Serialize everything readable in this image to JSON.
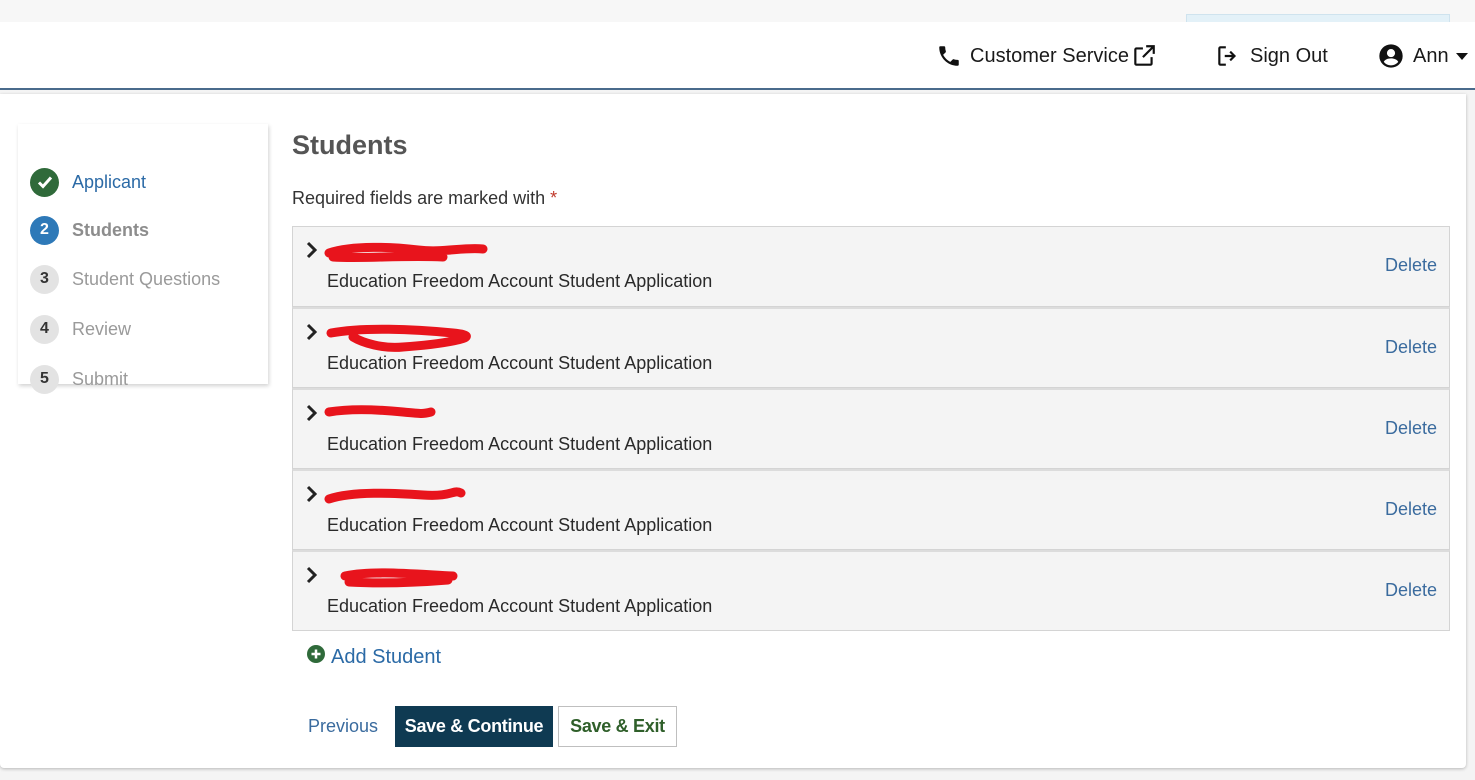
{
  "header": {
    "customer_service": "Customer Service",
    "sign_out": "Sign Out",
    "user_name": "Ann"
  },
  "stepper": {
    "steps": [
      {
        "number": "1",
        "label": "Applicant",
        "state": "done"
      },
      {
        "number": "2",
        "label": "Students",
        "state": "active"
      },
      {
        "number": "3",
        "label": "Student Questions",
        "state": "todo"
      },
      {
        "number": "4",
        "label": "Review",
        "state": "todo"
      },
      {
        "number": "5",
        "label": "Submit",
        "state": "todo"
      }
    ]
  },
  "main": {
    "title": "Students",
    "required_note": "Required fields are marked with",
    "required_star": "*",
    "students": [
      {
        "subtitle": "Education Freedom Account Student Application",
        "delete_label": "Delete"
      },
      {
        "subtitle": "Education Freedom Account Student Application",
        "delete_label": "Delete"
      },
      {
        "subtitle": "Education Freedom Account Student Application",
        "delete_label": "Delete"
      },
      {
        "subtitle": "Education Freedom Account Student Application",
        "delete_label": "Delete"
      },
      {
        "subtitle": "Education Freedom Account Student Application",
        "delete_label": "Delete"
      }
    ],
    "add_student": "Add Student"
  },
  "actions": {
    "previous": "Previous",
    "save_continue": "Save & Continue",
    "save_exit": "Save & Exit"
  },
  "colors": {
    "header_border": "#4a6b8c",
    "step_done": "#2f6a3a",
    "step_active": "#2e79b8",
    "link": "#2b6aa6",
    "primary_button": "#0f3a52",
    "secondary_button_text": "#2f5f2a",
    "redaction": "#e8141c"
  }
}
